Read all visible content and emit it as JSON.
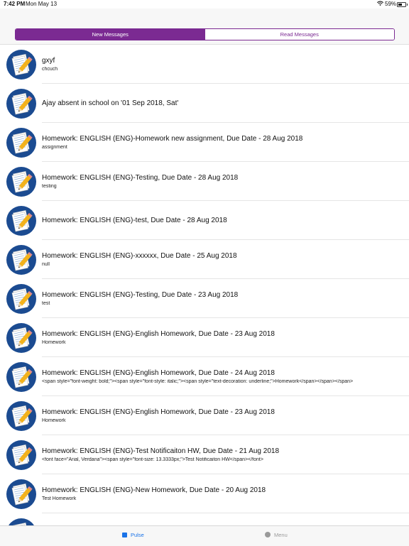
{
  "status_bar": {
    "time": "7:42 PM",
    "date": "Mon May 13",
    "battery_pct": "59%"
  },
  "segmented": {
    "new_label": "New Messages",
    "read_label": "Read Messages",
    "selected": "New Messages"
  },
  "colors": {
    "accent": "#7b2a92",
    "avatar": "#1b4b91",
    "tab_active": "#1a73e8"
  },
  "messages": [
    {
      "title": "gxyf",
      "subtitle": "chcuch"
    },
    {
      "title": "Ajay absent in school on '01 Sep 2018, Sat'",
      "subtitle": ""
    },
    {
      "title": "Homework: ENGLISH (ENG)-Homework new assignment, Due Date - 28 Aug 2018",
      "subtitle": "assignment"
    },
    {
      "title": "Homework: ENGLISH (ENG)-Testing, Due Date - 28 Aug 2018",
      "subtitle": "testing"
    },
    {
      "title": "Homework: ENGLISH (ENG)-test, Due Date - 28 Aug 2018",
      "subtitle": ""
    },
    {
      "title": "Homework: ENGLISH (ENG)-xxxxxx, Due Date - 25 Aug 2018",
      "subtitle": "null"
    },
    {
      "title": "Homework: ENGLISH (ENG)-Testing, Due Date - 23 Aug 2018",
      "subtitle": "test"
    },
    {
      "title": "Homework: ENGLISH (ENG)-English Homework, Due Date - 23 Aug 2018",
      "subtitle": "Homework"
    },
    {
      "title": "Homework: ENGLISH (ENG)-English Homework, Due Date - 24 Aug 2018",
      "subtitle": "<span style=\"font-weight: bold;\"><span style=\"font-style: italic;\"><span style=\"text-decoration: underline;\">Homework</span></span></span>"
    },
    {
      "title": "Homework: ENGLISH (ENG)-English Homework, Due Date - 23 Aug 2018",
      "subtitle": "Homework"
    },
    {
      "title": "Homework: ENGLISH (ENG)-Test Notificaiton HW, Due Date - 21 Aug 2018",
      "subtitle": "<font face=\"Arial, Verdana\"><span style=\"font-size: 13.3333px;\">Test Notificaiton HW</span></font>"
    },
    {
      "title": "Homework: ENGLISH (ENG)-New Homework, Due Date - 20 Aug 2018",
      "subtitle": "Test Homework"
    },
    {
      "title": "",
      "subtitle": ""
    }
  ],
  "tab_bar": {
    "pulse_label": "Pulse",
    "menu_label": "Menu"
  }
}
